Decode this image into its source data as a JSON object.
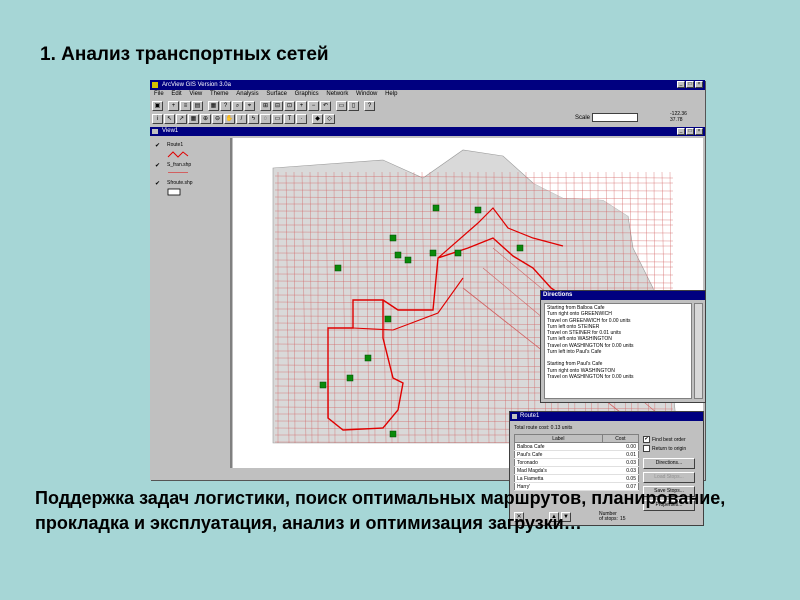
{
  "slide": {
    "title": "1. Анализ транспортных сетей",
    "caption": "Поддержка задач логистики, поиск оптимальных маршрутов, планирование, прокладка и эксплуатация, анализ и оптимизация загрузки…"
  },
  "app": {
    "window_title": "ArcView GIS Version 3.0a",
    "menu": [
      "File",
      "Edit",
      "View",
      "Theme",
      "Analysis",
      "Surface",
      "Graphics",
      "Network",
      "Window",
      "Help"
    ],
    "scale_label": "Scale 1:",
    "scale_value": "",
    "coords": [
      "-122.36",
      "37.78"
    ],
    "view_title": "View1"
  },
  "toc": {
    "items": [
      {
        "label": "Route1",
        "checked": true
      },
      {
        "label": "S_fran.shp",
        "checked": true
      },
      {
        "label": "Sfroute.shp",
        "checked": true
      }
    ]
  },
  "directions": {
    "title": "Directions",
    "lines": [
      "Starting from Balboa Cafe",
      "Turn right onto GREENWICH",
      "  Travel on GREENWICH for 0.00 units",
      "Turn left onto STEINER",
      "  Travel on STEINER for 0.01 units",
      "Turn left onto WASHINGTON",
      "  Travel on WASHINGTON for 0.00 units",
      "Turn left into Paul's Cafe",
      "",
      "Starting from Paul's Cafe",
      "Turn right onto WASHINGTON",
      "  Travel on WASHINGTON for 0.00 units"
    ]
  },
  "route": {
    "title": "Route1",
    "total_cost": "Total route cost: 0.13 units",
    "col_label": "Label",
    "col_cost": "Cost",
    "rows": [
      {
        "label": "Balboa Cafe",
        "cost": "0.00"
      },
      {
        "label": "Paul's Cafe",
        "cost": "0.01"
      },
      {
        "label": "Toronado",
        "cost": "0.03"
      },
      {
        "label": "Mad Magda's",
        "cost": "0.03"
      },
      {
        "label": "La Fiametta",
        "cost": "0.05"
      },
      {
        "label": "Harry'",
        "cost": "0.07"
      }
    ],
    "find_best_order": "Find best order",
    "return_to_origin": "Return to origin",
    "btn_directions": "Directions...",
    "btn_load_stops": "Load Stops...",
    "btn_save_stops": "Save Stops...",
    "btn_properties": "Properties...",
    "number_of_stops_label": "Number of stops:",
    "number_of_stops": "15"
  },
  "colors": {
    "desktop": "#a6d6d6",
    "street": "#d26060",
    "route_line": "#e00000",
    "stop": "#0a8a0a",
    "land": "#d9d9d9"
  }
}
